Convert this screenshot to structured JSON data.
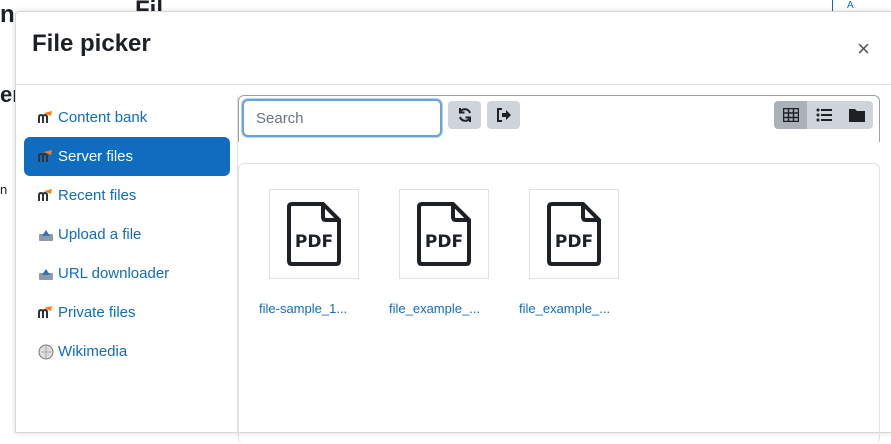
{
  "background": {
    "title_left": "n",
    "title_right": "Fil",
    "heading": "er",
    "small_text": "n",
    "button_label": "A"
  },
  "dialog": {
    "title": "File picker",
    "close_symbol": "×"
  },
  "sidebar": {
    "items": [
      {
        "label": "Content bank",
        "icon": "moodle-icon"
      },
      {
        "label": "Server files",
        "icon": "moodle-icon",
        "active": true
      },
      {
        "label": "Recent files",
        "icon": "moodle-icon"
      },
      {
        "label": "Upload a file",
        "icon": "upload-icon"
      },
      {
        "label": "URL downloader",
        "icon": "url-icon"
      },
      {
        "label": "Private files",
        "icon": "moodle-icon"
      },
      {
        "label": "Wikimedia",
        "icon": "wikimedia-icon"
      }
    ]
  },
  "toolbar": {
    "search_placeholder": "Search",
    "refresh_icon": "refresh-icon",
    "logout_icon": "logout-icon",
    "views": [
      "grid-view-icon",
      "list-view-icon",
      "folder-view-icon"
    ],
    "active_view": "grid-view-icon"
  },
  "files": [
    {
      "name": "file-sample_1...",
      "type": "PDF"
    },
    {
      "name": "file_example_...",
      "type": "PDF"
    },
    {
      "name": "file_example_...",
      "type": "PDF"
    }
  ],
  "colors": {
    "accent": "#0f6cbf",
    "button_bg": "#ced4da"
  }
}
